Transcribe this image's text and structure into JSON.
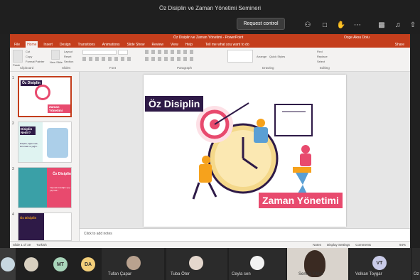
{
  "window": {
    "title": "Öz Disiplin ve Zaman Yönetimi Semineri"
  },
  "meeting": {
    "request_control": "Request control"
  },
  "powerpoint": {
    "title": "Öz Disiplin ve Zaman Yönetimi - PowerPoint",
    "user": "Ozge Aksu Dolu",
    "tabs": [
      "File",
      "Home",
      "Insert",
      "Design",
      "Transitions",
      "Animations",
      "Slide Show",
      "Review",
      "View",
      "Help"
    ],
    "tell_me": "Tell me what you want to do",
    "share": "Share",
    "ribbon_groups": [
      "Clipboard",
      "Slides",
      "Font",
      "Paragraph",
      "Drawing",
      "Editing"
    ],
    "ribbon_buttons": {
      "paste": "Paste",
      "new_slide": "New Slide",
      "layout": "Layout",
      "reset": "Reset",
      "section": "Section",
      "find": "Find",
      "replace": "Replace",
      "select": "Select",
      "arrange": "Arrange",
      "quick_styles": "Quick Styles",
      "cut": "Cut",
      "copy": "Copy",
      "format_painter": "Format Painter"
    },
    "slide_numbers": [
      "1",
      "2",
      "3",
      "4"
    ],
    "thumb1": {
      "title": "Öz Disiplin",
      "subtitle": "Zaman Yönetimi"
    },
    "thumb2": {
      "title": "Disiplin Nedir?",
      "body": "Disiplin; öğrenmek, korumak ve yeğin..."
    },
    "thumb3": {
      "title": "Öz Disiplin",
      "body": "Yapmak istediğin şeyi yapmak..."
    },
    "thumb4": {
      "title": "Öz Disiplin"
    },
    "slide": {
      "title": "Öz Disiplin",
      "subtitle": "Zaman Yönetimi"
    },
    "notes_placeholder": "Click to add notes",
    "status": {
      "slide": "Slide 1 of 19",
      "language": "Turkish",
      "notes": "Notes",
      "display": "Display Settings",
      "comments": "Comments",
      "zoom": "94%"
    }
  },
  "participants": [
    {
      "initials": "MT",
      "name": ""
    },
    {
      "initials": "DA",
      "name": ""
    },
    {
      "initials": "",
      "name": "Tufan Çapar"
    },
    {
      "initials": "",
      "name": "Tuba Öter"
    },
    {
      "initials": "",
      "name": "Ceyla sen"
    },
    {
      "initials": "",
      "name": "Semra Yıldız"
    },
    {
      "initials": "VT",
      "name": "Volkan Toygar"
    },
    {
      "initials": "",
      "name": "Oz"
    }
  ],
  "colors": {
    "ppt_red": "#c43e1c",
    "purple": "#2e1a47",
    "pink": "#e84a6e",
    "accent_orange": "#f6a21c"
  }
}
